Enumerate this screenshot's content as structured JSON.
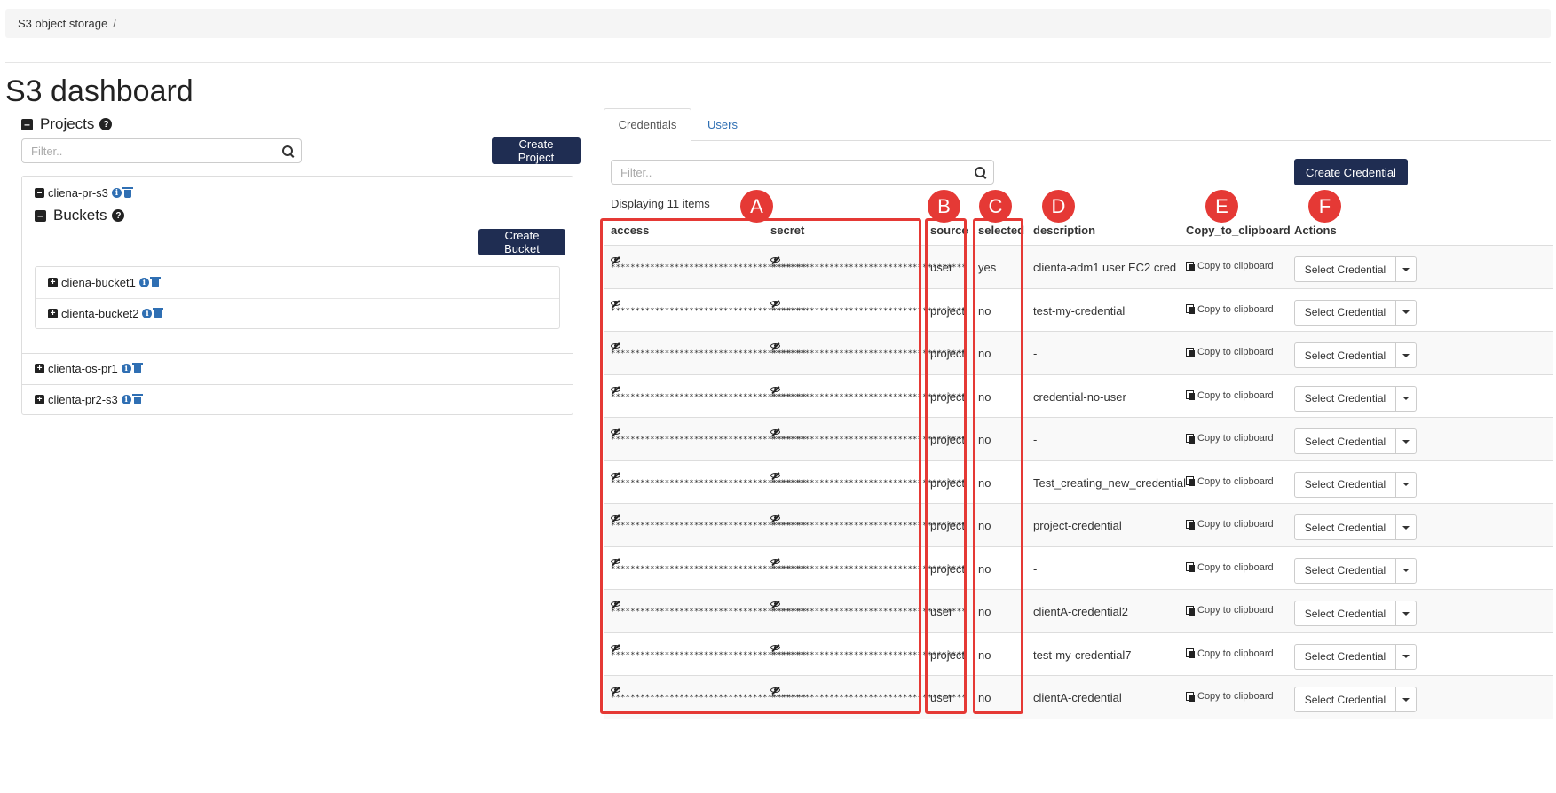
{
  "breadcrumb": {
    "item": "S3 object storage",
    "separator": "/"
  },
  "page_title": "S3 dashboard",
  "projects": {
    "heading": "Projects",
    "filter_placeholder": "Filter..",
    "create_button": "Create Project",
    "expanded_project": {
      "name": "cliena-pr-s3",
      "buckets_heading": "Buckets",
      "create_bucket_button": "Create Bucket",
      "buckets": [
        "cliena-bucket1",
        "clienta-bucket2"
      ]
    },
    "other_projects": [
      "clienta-os-pr1",
      "clienta-pr2-s3"
    ]
  },
  "tabs": [
    "Credentials",
    "Users"
  ],
  "credentials": {
    "filter_placeholder": "Filter..",
    "create_button": "Create Credential",
    "displaying": "Displaying 11 items",
    "masked": "****************************************",
    "copy_label": "Copy to clipboard",
    "action_label": "Select Credential",
    "columns": {
      "access": "access",
      "secret": "secret",
      "source": "source",
      "selected": "selected",
      "description": "description",
      "copy": "Copy_to_clipboard",
      "actions": "Actions"
    },
    "rows": [
      {
        "source": "user",
        "selected": "yes",
        "description": "clienta-adm1 user EC2 cred"
      },
      {
        "source": "project",
        "selected": "no",
        "description": "test-my-credential"
      },
      {
        "source": "project",
        "selected": "no",
        "description": "-"
      },
      {
        "source": "project",
        "selected": "no",
        "description": "credential-no-user"
      },
      {
        "source": "project",
        "selected": "no",
        "description": "-"
      },
      {
        "source": "project",
        "selected": "no",
        "description": "Test_creating_new_credential"
      },
      {
        "source": "project",
        "selected": "no",
        "description": "project-credential"
      },
      {
        "source": "project",
        "selected": "no",
        "description": "-"
      },
      {
        "source": "user",
        "selected": "no",
        "description": "clientA-credential2"
      },
      {
        "source": "project",
        "selected": "no",
        "description": "test-my-credential7"
      },
      {
        "source": "user",
        "selected": "no",
        "description": "clientA-credential"
      }
    ]
  },
  "annotations": [
    "A",
    "B",
    "C",
    "D",
    "E",
    "F"
  ],
  "colors": {
    "primary_button": "#1f2d52",
    "link": "#2f6fb3",
    "annotation": "#e53935"
  }
}
